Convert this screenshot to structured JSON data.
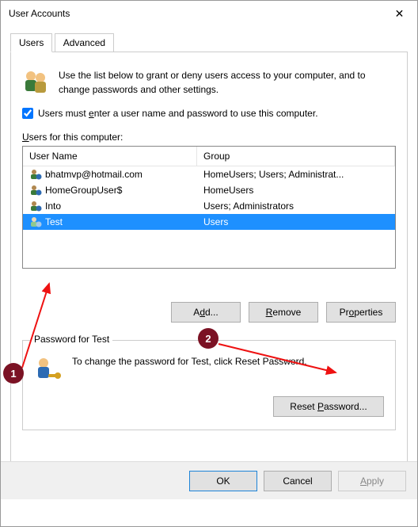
{
  "window": {
    "title": "User Accounts",
    "close_glyph": "✕"
  },
  "tabs": [
    {
      "label": "Users",
      "active": true
    },
    {
      "label": "Advanced",
      "active": false
    }
  ],
  "intro": "Use the list below to grant or deny users access to your computer, and to change passwords and other settings.",
  "checkbox": {
    "label_pre": "Users must ",
    "label_u": "e",
    "label_mid": "nter a user name and password to use this computer.",
    "checked": true
  },
  "list": {
    "label_pre": "",
    "label_u": "U",
    "label_post": "sers for this computer:",
    "columns": {
      "user": "User Name",
      "group": "Group"
    },
    "rows": [
      {
        "user": "bhatmvp@hotmail.com",
        "group": "HomeUsers; Users; Administrat...",
        "selected": false
      },
      {
        "user": "HomeGroupUser$",
        "group": "HomeUsers",
        "selected": false
      },
      {
        "user": "Into",
        "group": "Users; Administrators",
        "selected": false
      },
      {
        "user": "Test",
        "group": "Users",
        "selected": true
      }
    ]
  },
  "buttons": {
    "add": "Add...",
    "remove": "Remove",
    "properties": "Properties"
  },
  "password_group": {
    "legend": "Password for Test",
    "text": "To change the password for Test, click Reset Password.",
    "reset_label": "Reset Password..."
  },
  "bottom": {
    "ok": "OK",
    "cancel": "Cancel",
    "apply": "Apply"
  },
  "annotations": {
    "one": "1",
    "two": "2"
  }
}
